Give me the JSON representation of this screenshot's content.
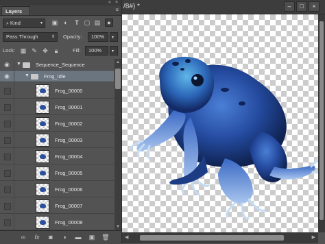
{
  "panel": {
    "title_controls": [
      "«",
      "×"
    ],
    "tab": "Layers",
    "tab_menu": "≡",
    "filter": {
      "kind_label": "Kind"
    },
    "blend_mode": "Pass Through",
    "opacity_label": "Opacity:",
    "opacity_value": "100%",
    "lock_label": "Lock:",
    "fill_label": "Fill:",
    "fill_value": "100%",
    "layers": [
      {
        "name": "Sequence_Sequence",
        "type": "group",
        "visible": true
      },
      {
        "name": "Frog_Idle",
        "type": "group",
        "visible": true,
        "selected": true
      },
      {
        "name": "Frog_00000",
        "type": "layer",
        "visible": false
      },
      {
        "name": "Frog_00001",
        "type": "layer",
        "visible": false
      },
      {
        "name": "Frog_00002",
        "type": "layer",
        "visible": false
      },
      {
        "name": "Frog_00003",
        "type": "layer",
        "visible": false
      },
      {
        "name": "Frog_00004",
        "type": "layer",
        "visible": false
      },
      {
        "name": "Frog_00005",
        "type": "layer",
        "visible": false
      },
      {
        "name": "Frog_00006",
        "type": "layer",
        "visible": false
      },
      {
        "name": "Frog_00007",
        "type": "layer",
        "visible": false
      },
      {
        "name": "Frog_00008",
        "type": "layer",
        "visible": false
      }
    ],
    "bottom_icons": [
      "link-icon",
      "fx-icon",
      "mask-icon",
      "adjustment-icon",
      "group-icon",
      "new-layer-icon",
      "trash-icon"
    ]
  },
  "document": {
    "title": "/8#) *",
    "window_buttons": [
      "–",
      "□",
      "×"
    ]
  },
  "colors": {
    "panel_bg": "#535353",
    "selected_row": "#6a7580",
    "frog_blue": "#2b4f9c"
  }
}
